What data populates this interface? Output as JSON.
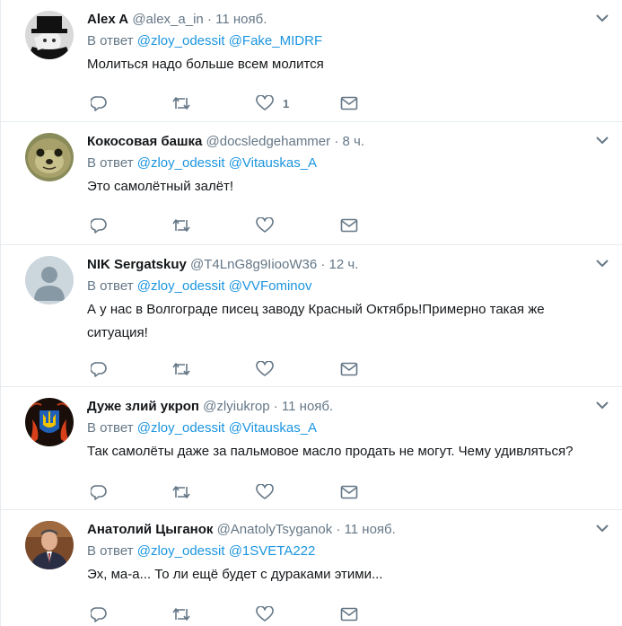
{
  "reply_prefix": "В ответ",
  "tweets": [
    {
      "fullname": "Alex A",
      "username": "@alex_a_in",
      "dot": "·",
      "time": "11 нояб.",
      "mentions": [
        "@zloy_odessit",
        "@Fake_MIDRF"
      ],
      "text": "Молиться надо больше всем молится",
      "like_count": "1",
      "avatar": "person-in-top-hat"
    },
    {
      "fullname": "Кокосовая башка",
      "username": "@docsledgehammer",
      "dot": "·",
      "time": "8 ч.",
      "mentions": [
        "@zloy_odessit",
        "@Vitauskas_A"
      ],
      "text": "Это самолётный залёт!",
      "like_count": "",
      "avatar": "seal-face"
    },
    {
      "fullname": "NIK Sergatskuy",
      "username": "@T4LnG8g9IiooW36",
      "dot": "·",
      "time": "12 ч.",
      "mentions": [
        "@zloy_odessit",
        "@VVFominov"
      ],
      "text": "А у нас в Волгограде писец заводу Красный Октябрь!Примерно такая же ситуация!",
      "like_count": "",
      "avatar": "default-profile"
    },
    {
      "fullname": "Дуже злий укроп",
      "username": "@zlyiukrop",
      "dot": "·",
      "time": "11 нояб.",
      "mentions": [
        "@zloy_odessit",
        "@Vitauskas_A"
      ],
      "text": "Так самолёты даже за пальмовое масло продать не могут. Чему удивляться?",
      "like_count": "",
      "avatar": "trident-emblem"
    },
    {
      "fullname": "Анатолий Цыганок",
      "username": "@AnatolyTsyganok",
      "dot": "·",
      "time": "11 нояб.",
      "mentions": [
        "@zloy_odessit",
        "@1SVETA222"
      ],
      "text": "Эх, ма-а... То ли ещё будет с дураками этими...",
      "like_count": "",
      "avatar": "man-in-suit"
    }
  ],
  "icons": {
    "reply": "reply-icon",
    "retweet": "retweet-icon",
    "like": "heart-icon",
    "message": "envelope-icon",
    "more": "chevron-down-icon"
  },
  "colors": {
    "text": "#14171a",
    "secondary": "#657786",
    "link": "#1b95e0",
    "border": "#e6ecf0"
  }
}
